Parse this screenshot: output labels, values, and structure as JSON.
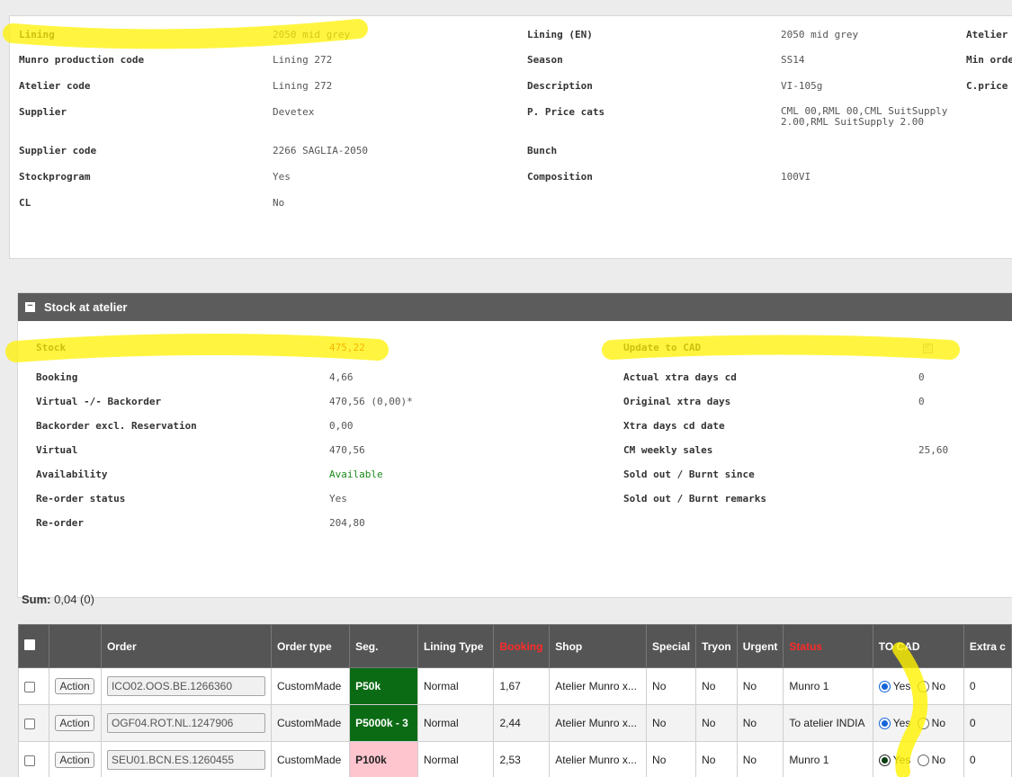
{
  "info": {
    "col1": [
      {
        "label": "Lining",
        "value": "2050 mid grey"
      },
      {
        "label": "Munro production code",
        "value": "Lining 272"
      },
      {
        "label": "Atelier code",
        "value": "Lining 272"
      },
      {
        "label": "Supplier",
        "value": "Devetex"
      },
      {
        "label": "Supplier code",
        "value": "2266 SAGLIA-2050"
      },
      {
        "label": "Stockprogram",
        "value": "Yes"
      },
      {
        "label": "CL",
        "value": "No"
      }
    ],
    "col2": [
      {
        "label": "Lining (EN)",
        "value": "2050 mid grey"
      },
      {
        "label": "Season",
        "value": "SS14"
      },
      {
        "label": "Description",
        "value": "VI-105g"
      },
      {
        "label": "P. Price cats",
        "value": "CML 00,RML 00,CML SuitSupply 2.00,RML SuitSupply 2.00"
      },
      {
        "label": "Bunch",
        "value": ""
      },
      {
        "label": "Composition",
        "value": "100VI"
      }
    ],
    "col3_labels": [
      "Atelier M",
      "Min orde",
      "C.price r"
    ]
  },
  "stock": {
    "title": "Stock at atelier",
    "collapse_glyph": "−",
    "left": [
      {
        "label": "Stock",
        "value": "475,22"
      },
      {
        "label": "Booking",
        "value": "4,66"
      },
      {
        "label": "Virtual -/- Backorder",
        "value": "470,56 (0,00)*"
      },
      {
        "label": "Backorder excl. Reservation",
        "value": "0,00"
      },
      {
        "label": "Virtual",
        "value": "470,56"
      },
      {
        "label": "Availability",
        "value": "Available"
      },
      {
        "label": "Re-order status",
        "value": "Yes"
      },
      {
        "label": "Re-order",
        "value": "204,80"
      }
    ],
    "right": [
      {
        "label": "Update to CAD",
        "value": ""
      },
      {
        "label": "Actual xtra days cd",
        "value": "0"
      },
      {
        "label": "Original xtra days",
        "value": "0"
      },
      {
        "label": "Xtra days cd date",
        "value": ""
      },
      {
        "label": "CM weekly sales",
        "value": "25,60"
      },
      {
        "label": "Sold out / Burnt since",
        "value": ""
      },
      {
        "label": "Sold out / Burnt remarks",
        "value": ""
      }
    ]
  },
  "sum": {
    "label": "Sum:",
    "value": "0,04 (0)"
  },
  "table": {
    "headers": [
      "Order",
      "Order type",
      "Seg.",
      "Lining Type",
      "Booking",
      "Shop",
      "Special",
      "Tryon",
      "Urgent",
      "Status",
      "TO CAD",
      "Extra c"
    ],
    "action_label": "Action",
    "yes_label": "Yes",
    "no_label": "No",
    "rows": [
      {
        "order": "ICO02.OOS.BE.1266360",
        "type": "CustomMade",
        "seg": "P50k",
        "lining_type": "Normal",
        "booking": "1,67",
        "shop": "Atelier Munro x...",
        "special": "No",
        "tryon": "No",
        "urgent": "No",
        "status": "Munro 1",
        "extra": "0"
      },
      {
        "order": "OGF04.ROT.NL.1247906",
        "type": "CustomMade",
        "seg": "P5000k - 3",
        "lining_type": "Normal",
        "booking": "2,44",
        "shop": "Atelier Munro x...",
        "special": "No",
        "tryon": "No",
        "urgent": "No",
        "status": "To atelier INDIA",
        "extra": "0"
      },
      {
        "order": "SEU01.BCN.ES.1260455",
        "type": "CustomMade",
        "seg": "P100k",
        "lining_type": "Normal",
        "booking": "2,53",
        "shop": "Atelier Munro x...",
        "special": "No",
        "tryon": "No",
        "urgent": "No",
        "status": "Munro 1",
        "extra": "0"
      }
    ]
  },
  "colors": {
    "highlight": "#fff200",
    "header_bg": "#5c5c5c",
    "seg_green": "#0a6b14",
    "seg_pink": "#ffc5cf",
    "stock_value": "#e00000",
    "available": "#1a8a1a"
  }
}
